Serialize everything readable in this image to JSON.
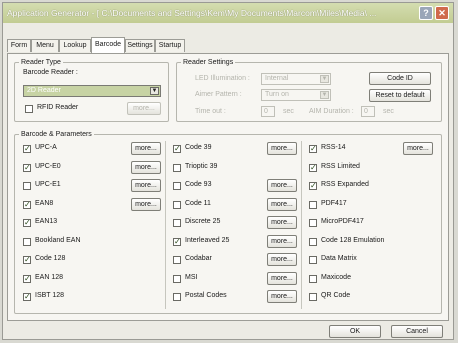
{
  "window": {
    "title": "Application Generator - [ C:\\Documents and Settings\\Kem\\My Documents\\Marcom\\Miles\\Media\\ ...",
    "help_label": "?",
    "close_label": "✕"
  },
  "tabs": [
    {
      "label": "Form"
    },
    {
      "label": "Menu"
    },
    {
      "label": "Lookup"
    },
    {
      "label": "Barcode"
    },
    {
      "label": "Settings"
    },
    {
      "label": "Startup"
    }
  ],
  "reader_type": {
    "group_label": "Reader Type",
    "barcode_reader_label": "Barcode Reader :",
    "barcode_reader_value": "2D Reader",
    "rfid_label": "RFID Reader",
    "rfid_checked": false,
    "rfid_more": "more..."
  },
  "reader_settings": {
    "group_label": "Reader Settings",
    "led_label": "LED Illumination :",
    "led_value": "Internal",
    "aimer_label": "Aimer Pattern :",
    "aimer_value": "Turn on",
    "timeout_label": "Time out :",
    "timeout_value": "0",
    "sec1": "sec",
    "aim_label": "AIM Duration :",
    "aim_value": "0",
    "sec2": "sec",
    "code_id_button": "Code ID",
    "reset_button": "Reset to default"
  },
  "symbologies": {
    "group_label": "Barcode & Parameters",
    "more_label": "more...",
    "check_mark": "✓",
    "col1": [
      {
        "name": "UPC-A",
        "checked": true,
        "more": true
      },
      {
        "name": "UPC-E0",
        "checked": true,
        "more": true
      },
      {
        "name": "UPC-E1",
        "checked": false,
        "more": true
      },
      {
        "name": "EAN8",
        "checked": true,
        "more": true
      },
      {
        "name": "EAN13",
        "checked": true,
        "more": false
      },
      {
        "name": "Bookland EAN",
        "checked": false,
        "more": false
      },
      {
        "name": "Code 128",
        "checked": true,
        "more": false
      },
      {
        "name": "EAN 128",
        "checked": true,
        "more": false
      },
      {
        "name": "ISBT 128",
        "checked": true,
        "more": false
      }
    ],
    "col2": [
      {
        "name": "Code 39",
        "checked": true,
        "more": true
      },
      {
        "name": "Trioptic 39",
        "checked": false,
        "more": false
      },
      {
        "name": "Code 93",
        "checked": false,
        "more": true
      },
      {
        "name": "Code 11",
        "checked": false,
        "more": true
      },
      {
        "name": "Discrete 25",
        "checked": false,
        "more": true
      },
      {
        "name": "Interleaved 25",
        "checked": true,
        "more": true
      },
      {
        "name": "Codabar",
        "checked": false,
        "more": true
      },
      {
        "name": "MSI",
        "checked": false,
        "more": true
      },
      {
        "name": "Postal Codes",
        "checked": false,
        "more": true
      }
    ],
    "col3": [
      {
        "name": "RSS-14",
        "checked": true,
        "more": true
      },
      {
        "name": "RSS Limited",
        "checked": true,
        "more": false
      },
      {
        "name": "RSS Expanded",
        "checked": true,
        "more": false
      },
      {
        "name": "PDF417",
        "checked": false,
        "more": false
      },
      {
        "name": "MicroPDF417",
        "checked": false,
        "more": false
      },
      {
        "name": "Code 128 Emulation",
        "checked": false,
        "more": false
      },
      {
        "name": "Data Matrix",
        "checked": false,
        "more": false
      },
      {
        "name": "Maxicode",
        "checked": false,
        "more": false
      },
      {
        "name": "QR Code",
        "checked": false,
        "more": false
      }
    ]
  },
  "footer": {
    "ok_button": "OK",
    "cancel_button": "Cancel"
  }
}
